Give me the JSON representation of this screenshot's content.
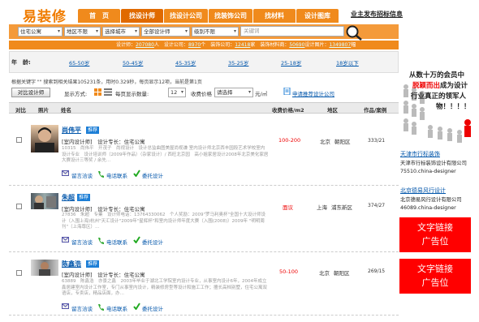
{
  "logo": "易装修",
  "nav": [
    {
      "label": "首　页"
    },
    {
      "label": "找设计师"
    },
    {
      "label": "找设计公司"
    },
    {
      "label": "找装饰公司"
    },
    {
      "label": "找材料"
    },
    {
      "label": "设计图库"
    }
  ],
  "business_link": "业主发布招标信息",
  "search": {
    "selects": [
      "住宅公寓",
      "地区不限",
      "选择城市",
      "全部设计师",
      "级别不限"
    ],
    "keyword_placeholder": "关键词"
  },
  "stats": {
    "prefix": "设计师：",
    "designers": "207080",
    "t1": "人　设计公司：",
    "design_cos": "8970",
    "t2": "个　装饰公司：",
    "deco_cos": "12418",
    "t3": "家　装饰材料商：",
    "materials": "50690",
    "t4": "设计图片：",
    "images": "1349807",
    "t5": "幅"
  },
  "age": {
    "label": "年　龄:",
    "ranges": [
      "65-50岁",
      "50-45岁",
      "45-35岁",
      "35-25岁",
      "25-18岁",
      "18岁以下"
    ]
  },
  "hint": "根据关键字 \"\" 搜索到相关结果105231条，用时0.329秒，每页显示12项，当前是第1页",
  "toolbar": {
    "compare_button": "对比设计师",
    "display_mode": "显示方式:",
    "per_page_label": "每页显示数量:",
    "per_page_value": "12",
    "fee_label": "收费价格",
    "fee_select": "请选择",
    "fee_unit": "元/㎡",
    "apply_link": "申请推荐设计公司"
  },
  "table_headers": {
    "compare": "对比",
    "photo": "照片",
    "name": "姓名",
    "price": "收费价格/m2",
    "region": "地区",
    "works": "作品/案例"
  },
  "designers": [
    {
      "name": "尚伟平",
      "badge": "推荐",
      "spec": "[室内设计师]　设计专长：住宅公寓",
      "desc": "10315　尚伟平　开茂子　尚视设计　设计总监曲图美屋尚视谦 室内设计师北京西丰园段艺术学校室内设计专业　设计培训师（2009年作品）（杂家设计）/ 西旺北京园　高小姐家居设计2008年北京美化家居大赛设计三等奖 / 余先…",
      "actions": [
        "留言洽谈",
        "电话联系",
        "委托设计"
      ],
      "price": "100-200",
      "city": "北京",
      "district": "朝阳区",
      "works": "333/21"
    },
    {
      "name": "朱超",
      "badge": "推荐",
      "spec": "[室内设计师]　设计专长：住宅公寓",
      "desc": "27836　朱超　专業　设计师电话：13764330062　个人奖励：2009\"罗马利奥杯\"全国十大设计师设计（入围上海)杭州\"天汇设计\"2009年\"星辉杯\"和室内设计师年度大赛（入围(2008)）2009年 \"明明周刊\"（上海尊区）…",
      "actions": [
        "留言洽谈",
        "电话联系",
        "委托设计"
      ],
      "price": "面议",
      "city": "上海",
      "district": "浦东新区",
      "works": "374/27"
    },
    {
      "name": "陈鑫浩",
      "badge": "推荐",
      "spec": "[室内设计师]　设计专长：住宅公寓",
      "desc": "63889　陈鑫浩　亦景之鑫　2003年毕业于湖北工学院室内设计专业，从事室内设计6年，2004年成立鑫居建室内设计工作室，专门从事室内设计，精装修房型等设计和施工工作；擅长高档别墅，住宅公寓双语店，专卖店，精品店面，办…",
      "actions": [
        "留言洽谈",
        "电话联系",
        "委托设计"
      ],
      "price": "50-100",
      "city": "北京",
      "district": "朝阳区",
      "works": "269/15"
    }
  ],
  "sidebar": {
    "promo_lines": [
      "从数十万的会员中",
      "脱颖而出",
      "成为设计",
      "行业真正的领军人",
      "物！！！！"
    ],
    "company1": {
      "link": "天津市行标装饰",
      "line1": "天津市行标装饰设计有限公司",
      "line2": "75510.china-designer"
    },
    "company2": {
      "link": "北京德易风行设计",
      "line1": "北京德易风行设计有限公司",
      "line2": "46089.china-designer"
    },
    "ads": [
      "文字链接",
      "广告位",
      "文字链接",
      "广告位"
    ]
  },
  "colors": {
    "brand_orange": "#f08a1c",
    "link_blue": "#0055aa",
    "price_red": "#ee0000",
    "badge_blue": "#1c7ed6"
  }
}
